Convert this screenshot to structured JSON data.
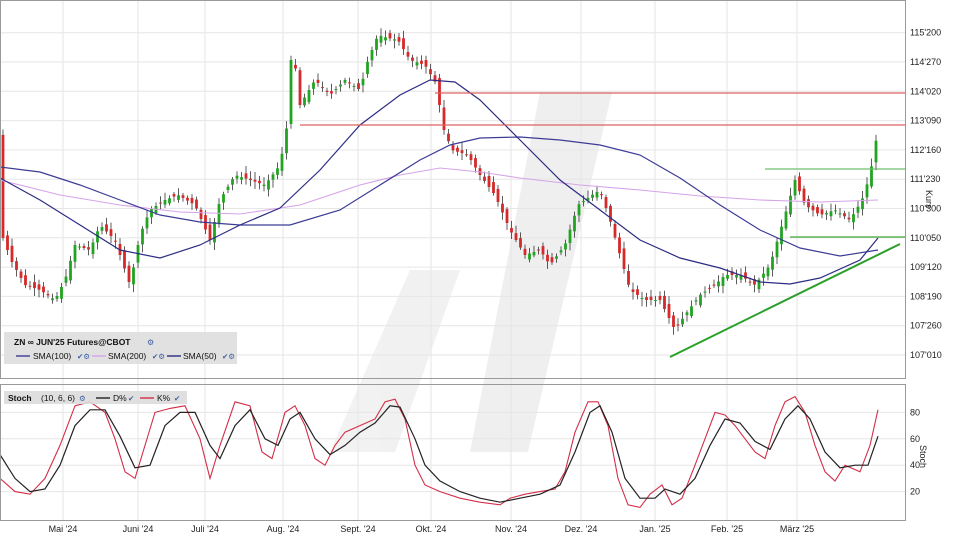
{
  "chart_data": [
    {
      "type": "candlestick",
      "instrument": "ZN ∞ JUN'25 Futures@CBOT",
      "y_axis_label": "Kurs",
      "y_ticks": [
        "107'010",
        "107'260",
        "108'190",
        "109'120",
        "110'050",
        "110'300",
        "111'230",
        "112'160",
        "113'090",
        "114'020",
        "114'270",
        "115'200"
      ],
      "x_ticks": [
        "Mai '24",
        "Juni '24",
        "Juli '24",
        "Aug. '24",
        "Sept. '24",
        "Okt. '24",
        "Nov. '24",
        "Dez. '24",
        "Jan. '25",
        "Feb. '25",
        "März '25"
      ],
      "x_range": [
        "2024-04-15",
        "2025-03-28"
      ],
      "legend": [
        {
          "name": "SMA(100)",
          "color": "#3c3c96"
        },
        {
          "name": "SMA(200)",
          "color": "#d6a4e8"
        },
        {
          "name": "SMA(50)",
          "color": "#2c2c84"
        }
      ],
      "close_approx": [
        [
          "2024-04-15",
          110.3
        ],
        [
          "2024-04-22",
          108.9
        ],
        [
          "2024-04-29",
          108.4
        ],
        [
          "2024-05-06",
          109.4
        ],
        [
          "2024-05-13",
          109.9
        ],
        [
          "2024-05-20",
          110.0
        ],
        [
          "2024-05-27",
          109.5
        ],
        [
          "2024-06-03",
          110.6
        ],
        [
          "2024-06-10",
          111.1
        ],
        [
          "2024-06-17",
          111.1
        ],
        [
          "2024-06-24",
          110.7
        ],
        [
          "2024-07-01",
          110.5
        ],
        [
          "2024-07-08",
          111.6
        ],
        [
          "2024-07-15",
          111.3
        ],
        [
          "2024-07-22",
          111.8
        ],
        [
          "2024-07-29",
          113.5
        ],
        [
          "2024-08-05",
          113.9
        ],
        [
          "2024-08-12",
          114.1
        ],
        [
          "2024-08-19",
          114.5
        ],
        [
          "2024-08-26",
          113.9
        ],
        [
          "2024-09-02",
          114.8
        ],
        [
          "2024-09-09",
          115.2
        ],
        [
          "2024-09-16",
          114.9
        ],
        [
          "2024-09-23",
          114.7
        ],
        [
          "2024-09-30",
          113.8
        ],
        [
          "2024-10-07",
          112.3
        ],
        [
          "2024-10-14",
          112.0
        ],
        [
          "2024-10-21",
          110.9
        ],
        [
          "2024-10-28",
          110.0
        ],
        [
          "2024-11-04",
          109.9
        ],
        [
          "2024-11-11",
          109.4
        ],
        [
          "2024-11-18",
          109.8
        ],
        [
          "2024-11-25",
          110.9
        ],
        [
          "2024-12-02",
          111.5
        ],
        [
          "2024-12-09",
          110.5
        ],
        [
          "2024-12-16",
          108.6
        ],
        [
          "2024-12-23",
          108.2
        ],
        [
          "2024-12-30",
          108.4
        ],
        [
          "2025-01-06",
          107.3
        ],
        [
          "2025-01-13",
          108.0
        ],
        [
          "2025-01-20",
          108.6
        ],
        [
          "2025-01-27",
          108.9
        ],
        [
          "2025-02-03",
          109.5
        ],
        [
          "2025-02-10",
          109.0
        ],
        [
          "2025-02-17",
          109.2
        ],
        [
          "2025-02-24",
          110.9
        ],
        [
          "2025-03-03",
          110.6
        ],
        [
          "2025-03-10",
          110.5
        ],
        [
          "2025-03-17",
          110.8
        ],
        [
          "2025-03-24",
          113.1
        ]
      ],
      "horizontal_lines": [
        {
          "value": 114.02,
          "color": "#e06060"
        },
        {
          "value": 113.09,
          "color": "#e06060"
        },
        {
          "value": 111.23,
          "color": "#6fbf6f"
        },
        {
          "value": 110.05,
          "color": "#3aaa3a"
        }
      ],
      "trendline": {
        "from": [
          "2025-01-06",
          107.0
        ],
        "to": [
          "2025-03-28",
          109.9
        ],
        "color": "#2aa02a"
      }
    },
    {
      "type": "line",
      "title": "Stoch",
      "params": "(10, 6, 6)",
      "y_axis_label": "Stoch",
      "y_ticks": [
        20,
        40,
        60,
        80
      ],
      "ylim": [
        0,
        100
      ],
      "series": [
        {
          "name": "D%",
          "color": "#222222"
        },
        {
          "name": "K%",
          "color": "#d22e48"
        }
      ]
    }
  ]
}
